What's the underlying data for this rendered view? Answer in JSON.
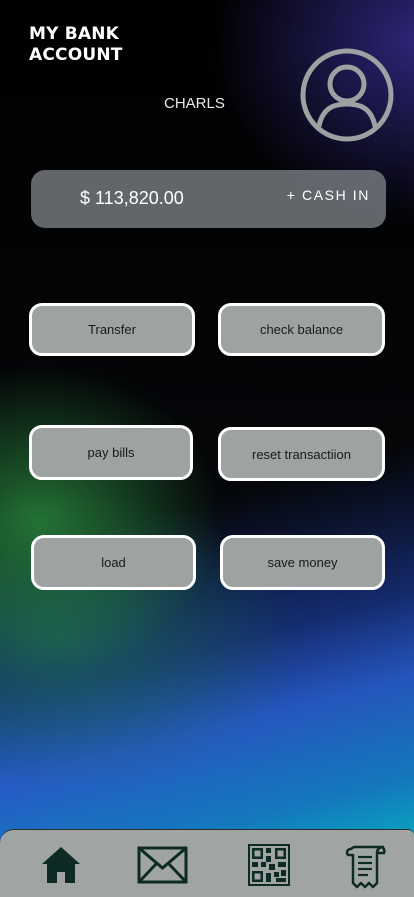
{
  "header": {
    "title_line1": "MY BANK",
    "title_line2": "ACCOUNT"
  },
  "user": {
    "name": "CHARLS",
    "avatar_icon": "user-circle-icon"
  },
  "balance": {
    "amount": "$ 113,820.00",
    "cash_in_label": "+ CASH IN"
  },
  "actions": {
    "transfer": "Transfer",
    "check_balance": "check balance",
    "pay_bills": "pay bills",
    "reset_transaction": "reset transactiion",
    "load": "load",
    "save_money": "save money"
  },
  "bottom_nav": {
    "items": [
      "home-icon",
      "mail-icon",
      "qr-code-icon",
      "receipt-icon"
    ]
  },
  "colors": {
    "button_bg": "#9ea3a2",
    "card_bg": "#7c8184",
    "nav_bg": "#a0a5a3",
    "icon_dark": "#0e2a24"
  }
}
